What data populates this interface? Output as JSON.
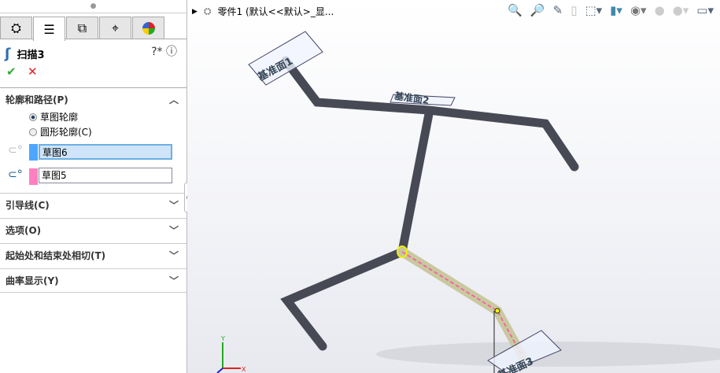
{
  "panel": {
    "tabs": [
      "feature-manager",
      "property-manager",
      "configuration-manager",
      "dimxpert-manager",
      "display-manager"
    ],
    "title": "扫描3",
    "sections": {
      "profile_path": {
        "label": "轮廓和路径(P)",
        "options": [
          "草图轮廓",
          "圆形轮廓(C)"
        ],
        "selected": "草图轮廓",
        "profile": "草图6",
        "path": "草图5"
      },
      "guides": "引导线(C)",
      "options": "选项(O)",
      "tangency": "起始处和结束处相切(T)",
      "curvature": "曲率显示(Y)"
    },
    "colors": {
      "profile": "#4da6ff",
      "path": "#ff80c0"
    }
  },
  "view": {
    "breadcrumb": "零件1  (默认<<默认>_显...",
    "planes": [
      "基准面1",
      "基准面2",
      "基准面3"
    ],
    "triad": {
      "x": "X",
      "y": "Y"
    }
  }
}
